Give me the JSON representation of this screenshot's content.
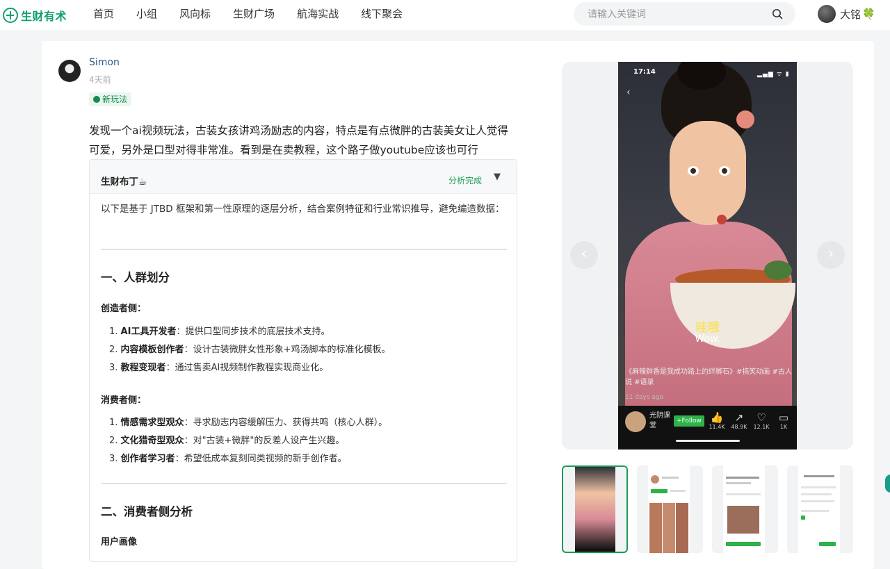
{
  "header": {
    "logo_text": "生财有术",
    "nav": [
      "首页",
      "小组",
      "风向标",
      "生财广场",
      "航海实战",
      "线下聚会"
    ],
    "search_placeholder": "请输入关键词",
    "user_name": "大铭",
    "user_badge": "🍀"
  },
  "post": {
    "author": "Simon",
    "time": "4天前",
    "tag": "新玩法",
    "text": "发现一个ai视频玩法，古装女孩讲鸡汤励志的内容，特点是有点微胖的古装美女让人觉得可爱，另外是口型对得非常准。看到是在卖教程，这个路子做youtube应该也可行"
  },
  "ai_analysis": {
    "title": "生财布丁☕",
    "status": "分析完成",
    "toggle": "▼",
    "intro": "以下是基于 JTBD 框架和第一性原理的逐层分析，结合案例特征和行业常识推导，避免编造数据：",
    "section1_title": "一、人群划分",
    "creators_title": "创造者侧：",
    "creators": [
      {
        "label": "AI工具开发者",
        "text": "：提供口型同步技术的底层技术支持。"
      },
      {
        "label": "内容模板创作者",
        "text": "：设计古装微胖女性形象+鸡汤脚本的标准化模板。"
      },
      {
        "label": "教程变现者",
        "text": "：通过售卖AI视频制作教程实现商业化。"
      }
    ],
    "consumers_title": "消费者侧：",
    "consumers": [
      {
        "label": "情感需求型观众",
        "text": "：寻求励志内容缓解压力、获得共鸣（核心人群）。"
      },
      {
        "label": "文化猎奇型观众",
        "text": "：对\"古装+微胖\"的反差人设产生兴趣。"
      },
      {
        "label": "创作者学习者",
        "text": "：希望低成本复刻同类视频的新手创作者。"
      }
    ],
    "section2_title": "二、消费者侧分析",
    "persona_title": "用户画像"
  },
  "media": {
    "phone_time": "17:14",
    "phone_status": "▂▄▆ ᯤ ▮",
    "subtitle_zh": "哇哦",
    "subtitle_en": "Wow.",
    "caption": "《麻辣鲜香是我成功路上的绊脚石》#搞笑动画 #古人说 #语录",
    "ago": "11 days ago",
    "channel": "光阴课堂",
    "follow": "+Follow",
    "stats": [
      {
        "icon": "👍",
        "value": "11.4K"
      },
      {
        "icon": "↗",
        "value": "48.9K"
      },
      {
        "icon": "♡",
        "value": "12.1K"
      },
      {
        "icon": "▭",
        "value": "1K"
      }
    ],
    "prev": "‹",
    "next": "›"
  }
}
